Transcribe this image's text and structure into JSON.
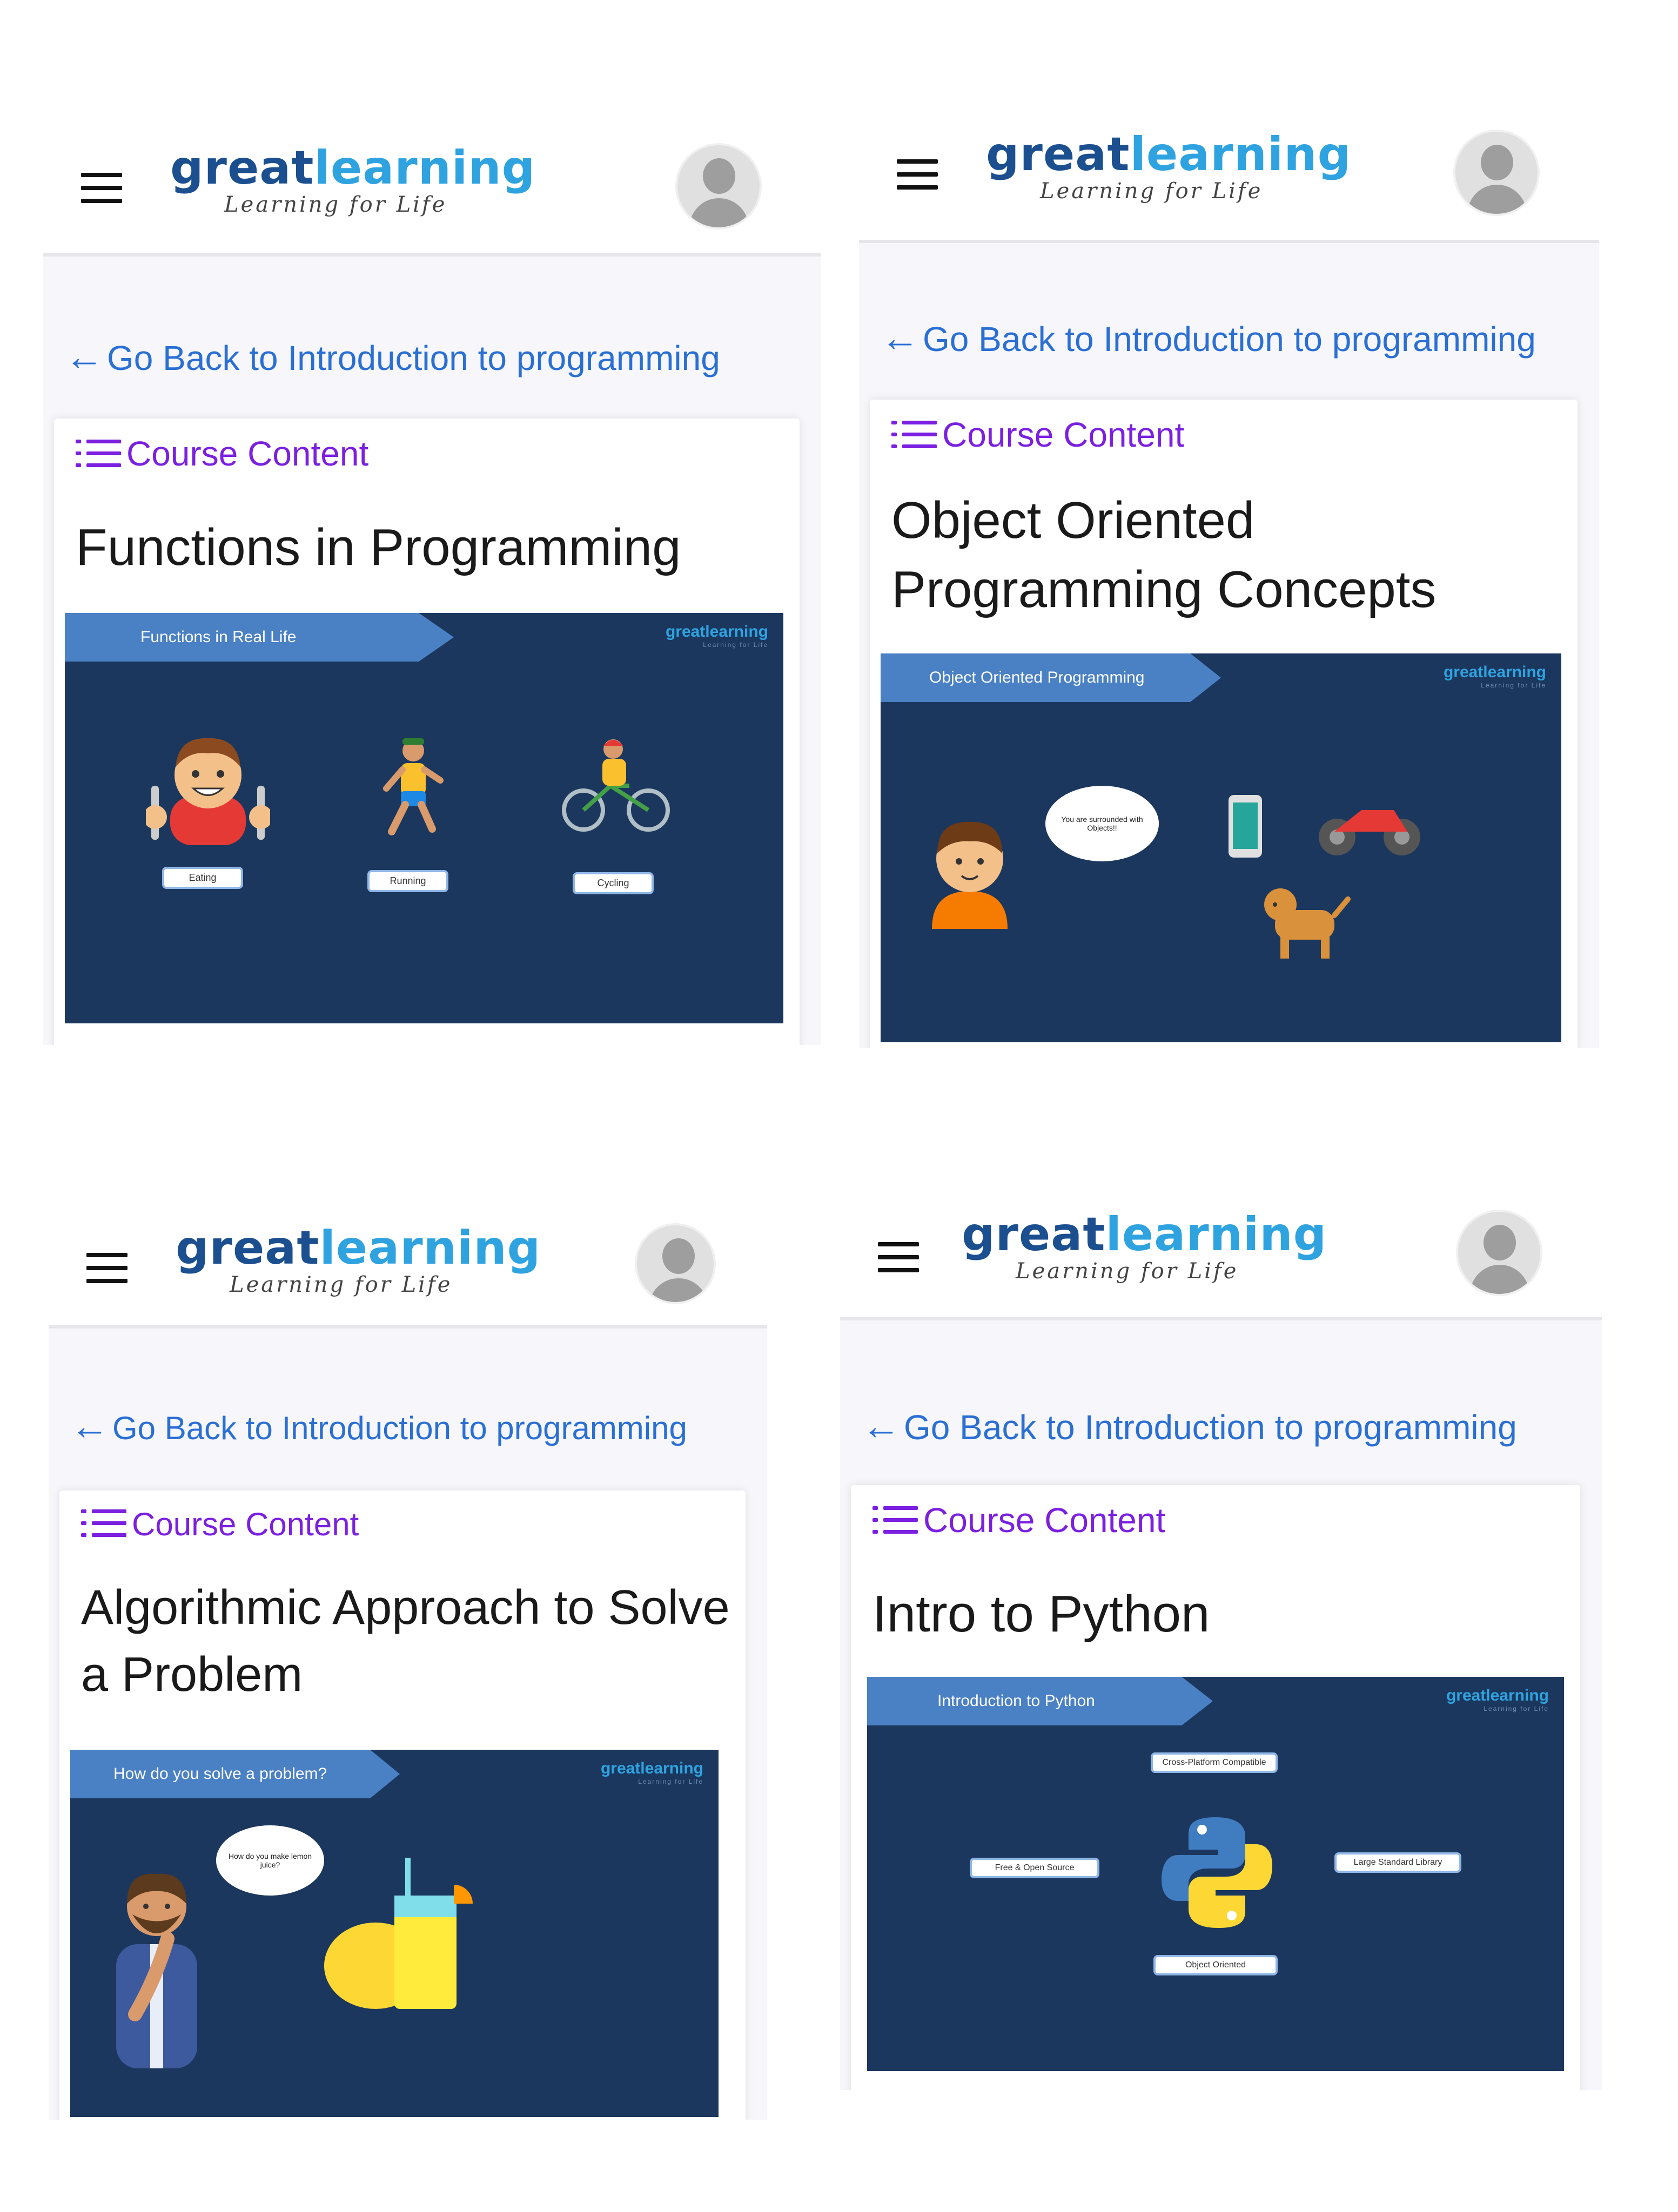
{
  "brand": {
    "name_part1": "great",
    "name_part2": "learning",
    "tagline": "Learning for Life",
    "primary_color": "#1b4f8f",
    "accent_color": "#2fa3e0"
  },
  "icons": {
    "menu": "hamburger-menu-icon",
    "avatar": "user-avatar-icon",
    "back": "arrow-left-icon",
    "course_content": "list-icon"
  },
  "colors": {
    "link": "#2a6fd4",
    "course_content": "#7b1fe0",
    "slide_background": "#1b375d",
    "slide_banner": "#4a80c4"
  },
  "panels": [
    {
      "back_link": "Go Back to Introduction to programming",
      "course_content": "Course Content",
      "title": "Functions in Programming",
      "slide": {
        "banner": "Functions in Real Life",
        "labels": [
          "Eating",
          "Running",
          "Cycling"
        ]
      }
    },
    {
      "back_link": "Go Back to Introduction to programming",
      "course_content": "Course Content",
      "title": "Object Oriented Programming Concepts",
      "slide": {
        "banner": "Object Oriented Programming",
        "bubble": "You are surrounded with Objects!!"
      }
    },
    {
      "back_link": "Go Back to Introduction to programming",
      "course_content": "Course Content",
      "title": "Algorithmic Approach to Solve a Problem",
      "slide": {
        "banner": "How do you solve a problem?",
        "bubble": "How do you make lemon juice?"
      }
    },
    {
      "back_link": "Go Back to Introduction to programming",
      "course_content": "Course Content",
      "title": "Intro to Python",
      "slide": {
        "banner": "Introduction to Python",
        "labels": [
          "Cross-Platform Compatible",
          "Free & Open Source",
          "Large Standard Library",
          "Object Oriented"
        ]
      }
    }
  ]
}
